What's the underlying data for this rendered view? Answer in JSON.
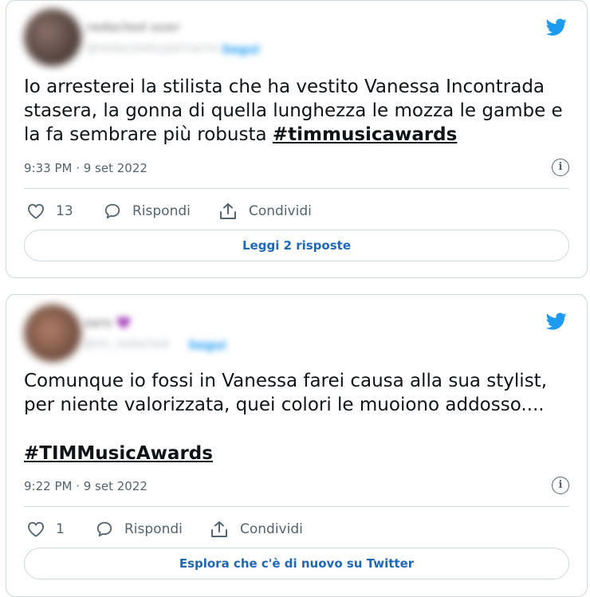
{
  "tweets": [
    {
      "text": "Io arresterei la stilista che ha vestito Vanessa Incontrada stasera, la gonna di quella lunghezza le mozza le gambe e la fa sembrare più robusta ",
      "hashtag": "#timmusicawards",
      "timestamp": "9:33 PM · 9 set 2022",
      "likes": "13",
      "reply_label": "Rispondi",
      "share_label": "Condividi",
      "button_label": "Leggi 2 risposte"
    },
    {
      "text": "Comunque io fossi in Vanessa farei causa alla sua stylist, per niente valorizzata, quei colori le muoiono addosso....",
      "hashtag": "#TIMMusicAwards",
      "timestamp": "9:22 PM · 9 set 2022",
      "likes": "1",
      "reply_label": "Rispondi",
      "share_label": "Condividi",
      "button_label": "Esplora che c'è di nuovo su Twitter"
    }
  ],
  "icons": {
    "brand": "twitter-bird-icon",
    "like": "heart-icon",
    "reply": "speech-bubble-icon",
    "share": "share-arrow-icon",
    "info": "info-icon"
  },
  "colors": {
    "twitter_blue": "#1d9bf0",
    "link_text": "#1d68b8",
    "secondary_text": "#536471",
    "border": "#cfd9de"
  }
}
